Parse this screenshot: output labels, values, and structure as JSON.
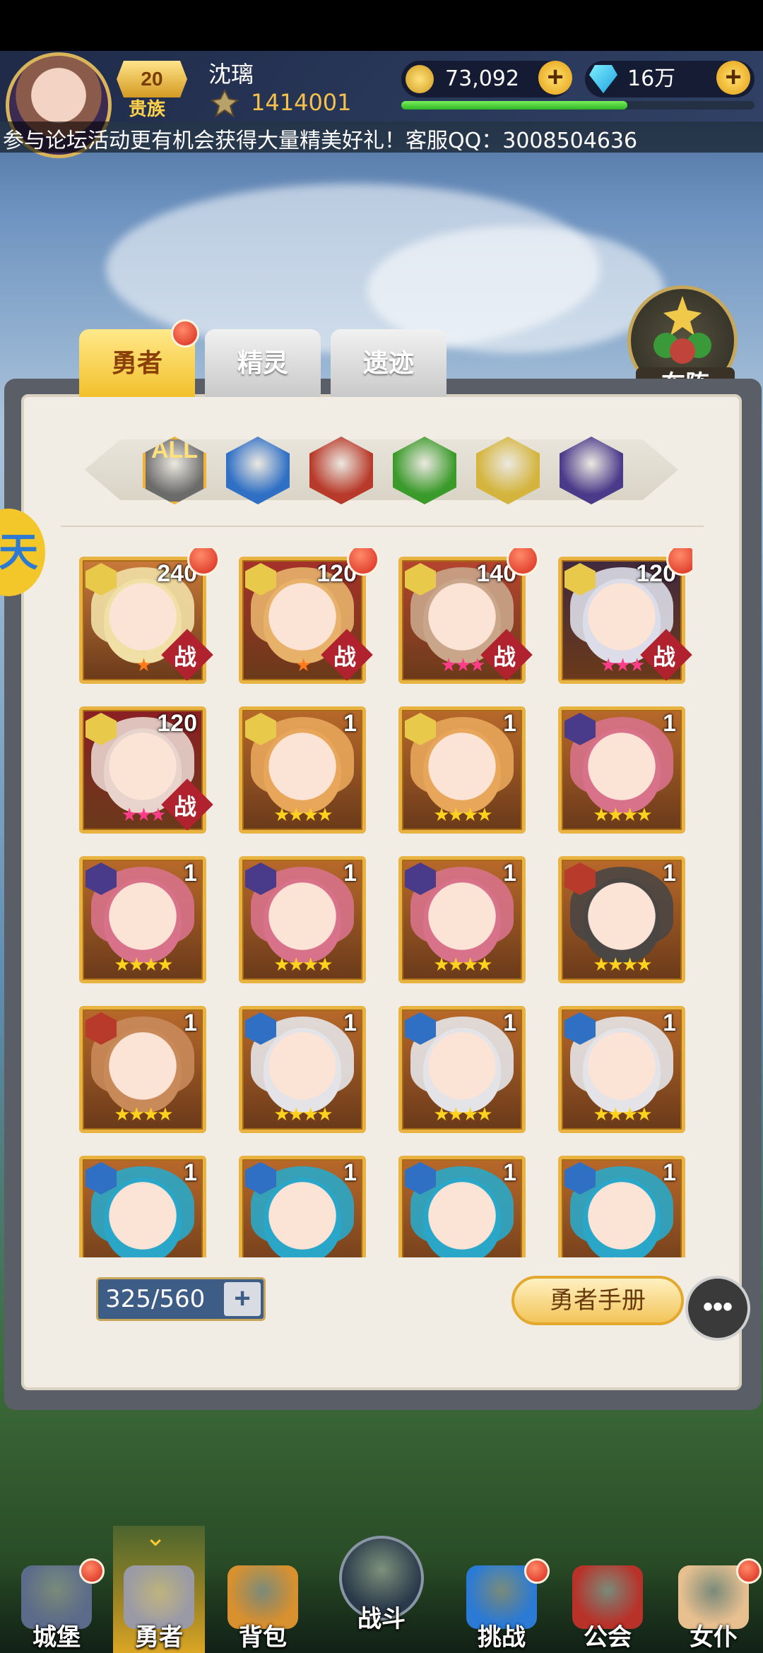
{
  "player": {
    "name": "沈璃",
    "vip_level": "20",
    "vip_title": "贵族",
    "power": "1414001",
    "gold": "73,092",
    "diamonds": "16万",
    "xp_fraction": 0.64
  },
  "marquee": "参与论坛活动更有机会获得大量精美好礼！客服QQ：3008504636",
  "tabs": [
    {
      "label": "勇者",
      "active": true,
      "badge": true
    },
    {
      "label": "精灵",
      "active": false
    },
    {
      "label": "遗迹",
      "active": false
    }
  ],
  "formation_label": "布阵",
  "left_float_label": "天",
  "filters": [
    {
      "label": "ALL",
      "icon": "all-filter-icon",
      "color": "#6b6b6b"
    },
    {
      "label": "",
      "icon": "water-element-icon",
      "color": "#2f6fc4"
    },
    {
      "label": "",
      "icon": "fire-element-icon",
      "color": "#b83a2a"
    },
    {
      "label": "",
      "icon": "wind-element-icon",
      "color": "#3a9a2a"
    },
    {
      "label": "",
      "icon": "light-element-icon",
      "color": "#d4b43c"
    },
    {
      "label": "",
      "icon": "dark-element-icon",
      "color": "#4a3a8a"
    }
  ],
  "heroes": [
    {
      "level": "240",
      "element": "light",
      "stars": "★",
      "in_battle": true,
      "badge": true,
      "bg": "#c97a3a",
      "hair": "#f1e0a6"
    },
    {
      "level": "120",
      "element": "light",
      "stars": "★",
      "in_battle": true,
      "badge": true,
      "bg": "#a5322a",
      "hair": "#e7b16a"
    },
    {
      "level": "140",
      "element": "light",
      "stars": "★★★",
      "in_battle": true,
      "badge": true,
      "bg": "#b5452e",
      "hair": "#c9a58a"
    },
    {
      "level": "120",
      "element": "light",
      "stars": "★★★",
      "in_battle": true,
      "badge": true,
      "bg": "#402a3e",
      "hair": "#dcdde8"
    },
    {
      "level": "120",
      "element": "light",
      "stars": "★★★",
      "in_battle": true,
      "badge": false,
      "bg": "#8a1f24",
      "hair": "#e8d4cc"
    },
    {
      "level": "1",
      "element": "light",
      "stars": "★★★★",
      "in_battle": false,
      "badge": false,
      "bg": "#b8692a",
      "hair": "#e7a65a"
    },
    {
      "level": "1",
      "element": "light",
      "stars": "★★★★",
      "in_battle": false,
      "badge": false,
      "bg": "#b8692a",
      "hair": "#e7a65a"
    },
    {
      "level": "1",
      "element": "dark",
      "stars": "★★★★",
      "in_battle": false,
      "badge": false,
      "bg": "#b8692a",
      "hair": "#d7728a"
    },
    {
      "level": "1",
      "element": "dark",
      "stars": "★★★★",
      "in_battle": false,
      "badge": false,
      "bg": "#b8692a",
      "hair": "#d7728a"
    },
    {
      "level": "1",
      "element": "dark",
      "stars": "★★★★",
      "in_battle": false,
      "badge": false,
      "bg": "#b8692a",
      "hair": "#d7728a"
    },
    {
      "level": "1",
      "element": "dark",
      "stars": "★★★★",
      "in_battle": false,
      "badge": false,
      "bg": "#b8692a",
      "hair": "#d7728a"
    },
    {
      "level": "1",
      "element": "fire",
      "stars": "★★★★",
      "in_battle": false,
      "badge": false,
      "bg": "#b8692a",
      "hair": "#4a4644"
    },
    {
      "level": "1",
      "element": "fire",
      "stars": "★★★★",
      "in_battle": false,
      "badge": false,
      "bg": "#b8692a",
      "hair": "#c98a5a"
    },
    {
      "level": "1",
      "element": "water",
      "stars": "★★★★",
      "in_battle": false,
      "badge": false,
      "bg": "#b8692a",
      "hair": "#e4e4e8"
    },
    {
      "level": "1",
      "element": "water",
      "stars": "★★★★",
      "in_battle": false,
      "badge": false,
      "bg": "#b8692a",
      "hair": "#e4e4e8"
    },
    {
      "level": "1",
      "element": "water",
      "stars": "★★★★",
      "in_battle": false,
      "badge": false,
      "bg": "#b8692a",
      "hair": "#e4e4e8"
    },
    {
      "level": "1",
      "element": "water",
      "stars": "★★★★",
      "in_battle": false,
      "badge": false,
      "bg": "#b8692a",
      "hair": "#2aa7c8"
    },
    {
      "level": "1",
      "element": "water",
      "stars": "★★★★",
      "in_battle": false,
      "badge": false,
      "bg": "#b8692a",
      "hair": "#2aa7c8"
    },
    {
      "level": "1",
      "element": "water",
      "stars": "★★★★",
      "in_battle": false,
      "badge": false,
      "bg": "#b8692a",
      "hair": "#2aa7c8"
    },
    {
      "level": "1",
      "element": "water",
      "stars": "★★★★",
      "in_battle": false,
      "badge": false,
      "bg": "#b8692a",
      "hair": "#2aa7c8"
    }
  ],
  "battle_label": "战",
  "element_colors": {
    "light": "#e8c94a",
    "dark": "#4a3a8a",
    "fire": "#b83a2a",
    "water": "#2f6fc4"
  },
  "capacity": "325/560",
  "capacity_plus": "+",
  "manual_button": "勇者手册",
  "chat_icon": "•••",
  "nav": [
    {
      "label": "城堡",
      "icon": "castle-icon",
      "badge": true,
      "color": "#5c6b8a"
    },
    {
      "label": "勇者",
      "icon": "helmet-icon",
      "badge": false,
      "active": true,
      "color": "#9a9aa6"
    },
    {
      "label": "背包",
      "icon": "chest-icon",
      "badge": false,
      "color": "#d9902e"
    },
    {
      "label": "战斗",
      "icon": "swords-icon",
      "badge": false,
      "color": "#2a3a4a"
    },
    {
      "label": "挑战",
      "icon": "portal-icon",
      "badge": true,
      "color": "#2a7ad6"
    },
    {
      "label": "公会",
      "icon": "guild-crest-icon",
      "badge": false,
      "color": "#b8322a"
    },
    {
      "label": "女仆",
      "icon": "maid-icon",
      "badge": true,
      "color": "#e8c090"
    }
  ]
}
